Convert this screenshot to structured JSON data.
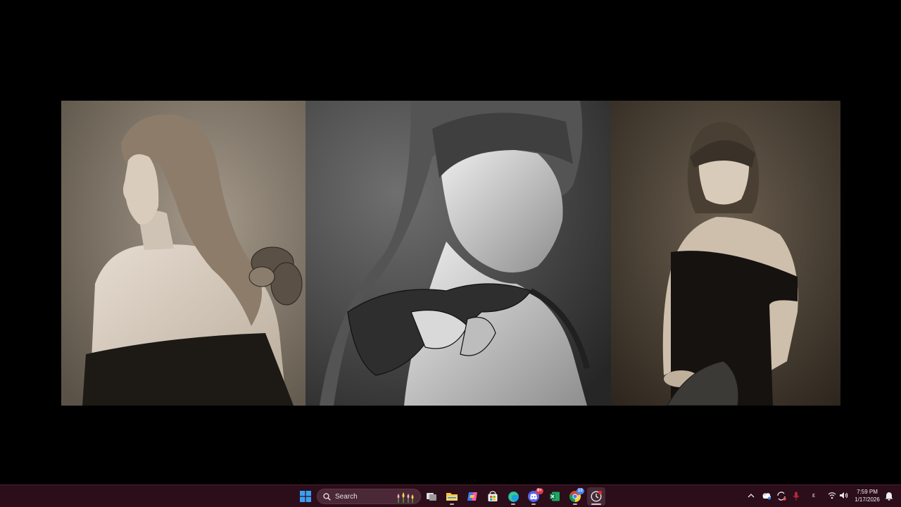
{
  "desktop": {
    "wallpaper": {
      "description_panels": [
        "sepia-portrait-back-view",
        "bw-portrait-closeup-shoulder",
        "sepia-portrait-strapless-dress"
      ]
    }
  },
  "taskbar": {
    "background_color": "#2c0d1a",
    "start_icon": "windows-start-icon",
    "search": {
      "placeholder": "Search",
      "icon": "search-icon",
      "deco": "tulips-highlight-icon"
    },
    "pinned_apps": [
      {
        "name": "task-view",
        "icon": "task-view-icon"
      },
      {
        "name": "file-explorer",
        "icon": "folder-icon",
        "running": true
      },
      {
        "name": "copilot",
        "icon": "copilot-icon"
      },
      {
        "name": "microsoft-store",
        "icon": "store-icon"
      },
      {
        "name": "edge",
        "icon": "edge-icon",
        "running": true
      },
      {
        "name": "discord",
        "icon": "discord-icon",
        "badge": "9+",
        "running": true
      },
      {
        "name": "excel",
        "icon": "excel-icon"
      },
      {
        "name": "chrome",
        "icon": "chrome-icon",
        "badge": "13",
        "running": true
      },
      {
        "name": "clock-app",
        "icon": "clock-app-icon",
        "badge": "",
        "active": true
      }
    ],
    "tray": {
      "overflow_icon": "chevron-up-icon",
      "icons": [
        "onedrive-icon",
        "sync-icon",
        "microphone-icon"
      ],
      "ime_label": "ε",
      "network_icon": "wifi-icon",
      "volume_icon": "speaker-icon",
      "time": "7:59 PM",
      "date": "1/17/2026",
      "notification_icon": "notification-bell-icon"
    }
  }
}
